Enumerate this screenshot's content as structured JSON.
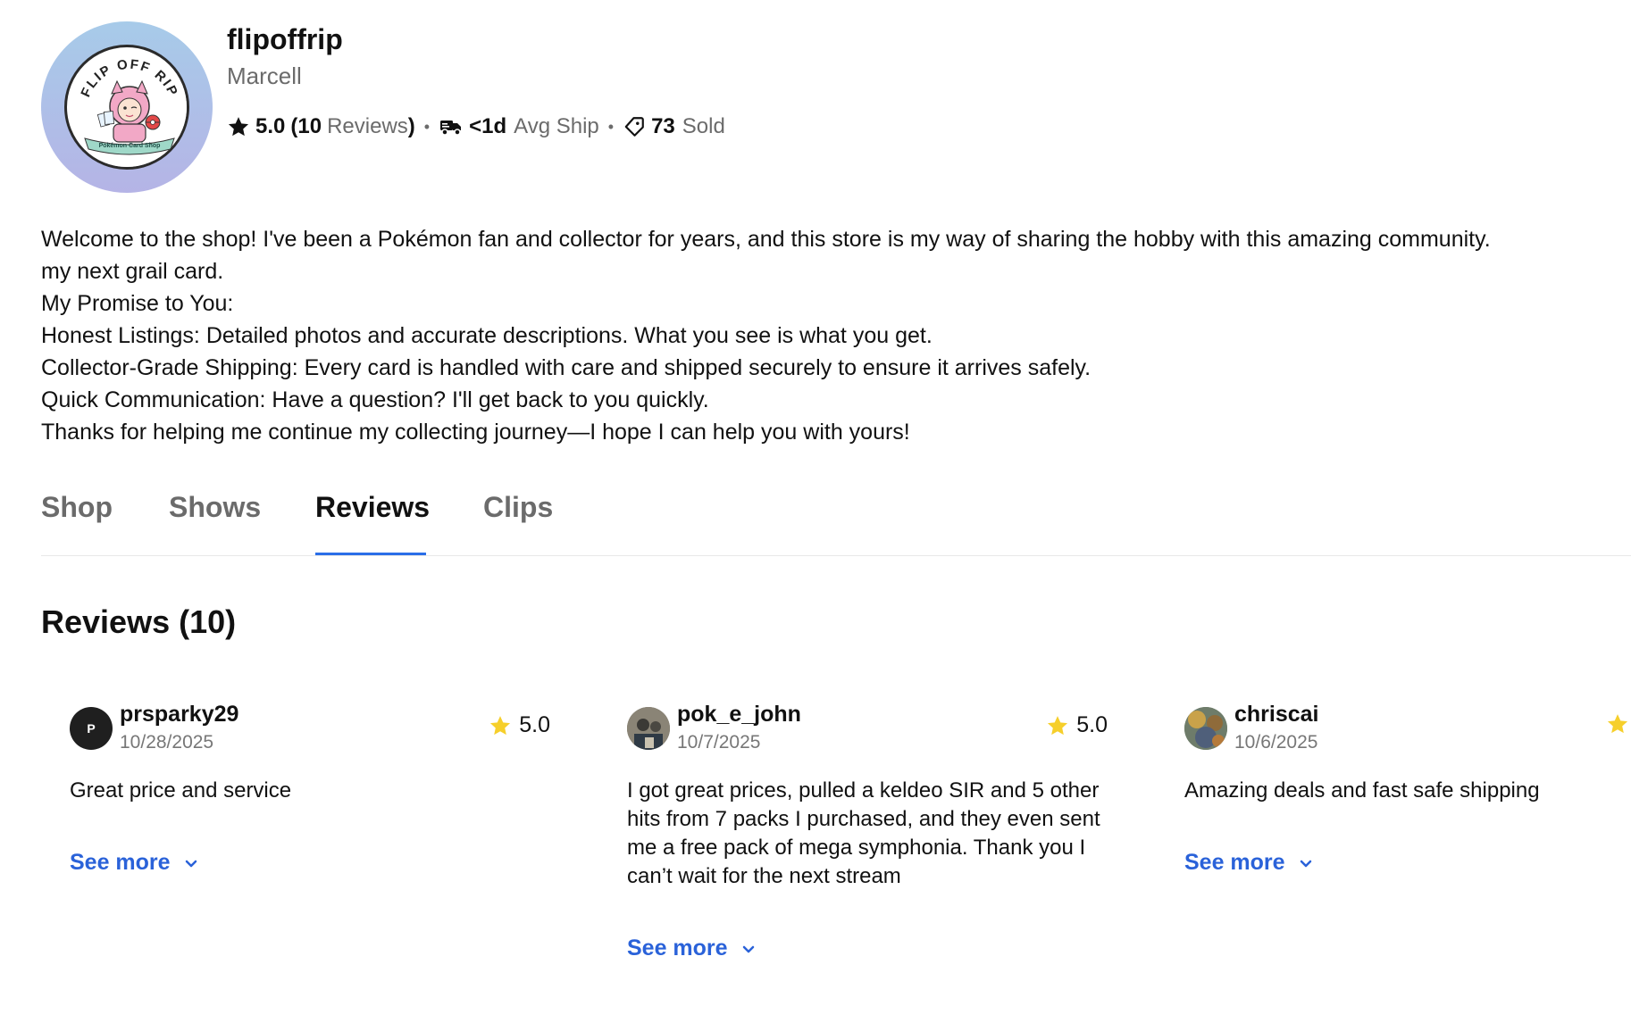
{
  "profile": {
    "username": "flipoffrip",
    "display_name": "Marcell",
    "avatar_icon": "flip-off-rip-logo",
    "avatar_text_top": "FLIP OFF RIP",
    "avatar_text_banner": "Pokémon Card Shop",
    "rating": "5.0",
    "reviews_open": "(",
    "reviews_count": "10",
    "reviews_label": "Reviews",
    "reviews_close": ")",
    "ship_value": "<1d",
    "ship_label": "Avg Ship",
    "sold_value": "73",
    "sold_label": "Sold"
  },
  "bio": {
    "lines": [
      "Welcome to the shop! I've been a Pokémon fan and collector for years, and this store is my way of sharing the hobby with this amazing community.",
      "my next grail card.",
      "My Promise to You:",
      "Honest Listings: Detailed photos and accurate descriptions. What you see is what you get.",
      "Collector-Grade Shipping: Every card is handled with care and shipped securely to ensure it arrives safely.",
      "Quick Communication: Have a question? I'll get back to you quickly.",
      "Thanks for helping me continue my collecting journey—I hope I can help you with yours!"
    ]
  },
  "tabs": [
    {
      "label": "Shop"
    },
    {
      "label": "Shows"
    },
    {
      "label": "Reviews",
      "active": true
    },
    {
      "label": "Clips"
    }
  ],
  "reviews": {
    "heading": "Reviews (10)",
    "see_more_label": "See more",
    "items": [
      {
        "user": "prsparky29",
        "avatar_letter": "P",
        "date": "10/28/2025",
        "rating": "5.0",
        "text": "Great price and service"
      },
      {
        "user": "pok_e_john",
        "date": "10/7/2025",
        "rating": "5.0",
        "text": "I got great prices, pulled a keldeo SIR and 5 other hits from 7 packs I purchased, and they even sent me a free pack of mega symphonia. Thank you I can’t wait for the next stream"
      },
      {
        "user": "chriscai",
        "date": "10/6/2025",
        "rating": "",
        "text": "Amazing deals and fast safe shipping"
      }
    ]
  },
  "colors": {
    "accent_blue": "#2a6ee8",
    "link_blue": "#2a62d9",
    "star_yellow": "#f6cf2b",
    "muted_gray": "#6b6b6b"
  }
}
